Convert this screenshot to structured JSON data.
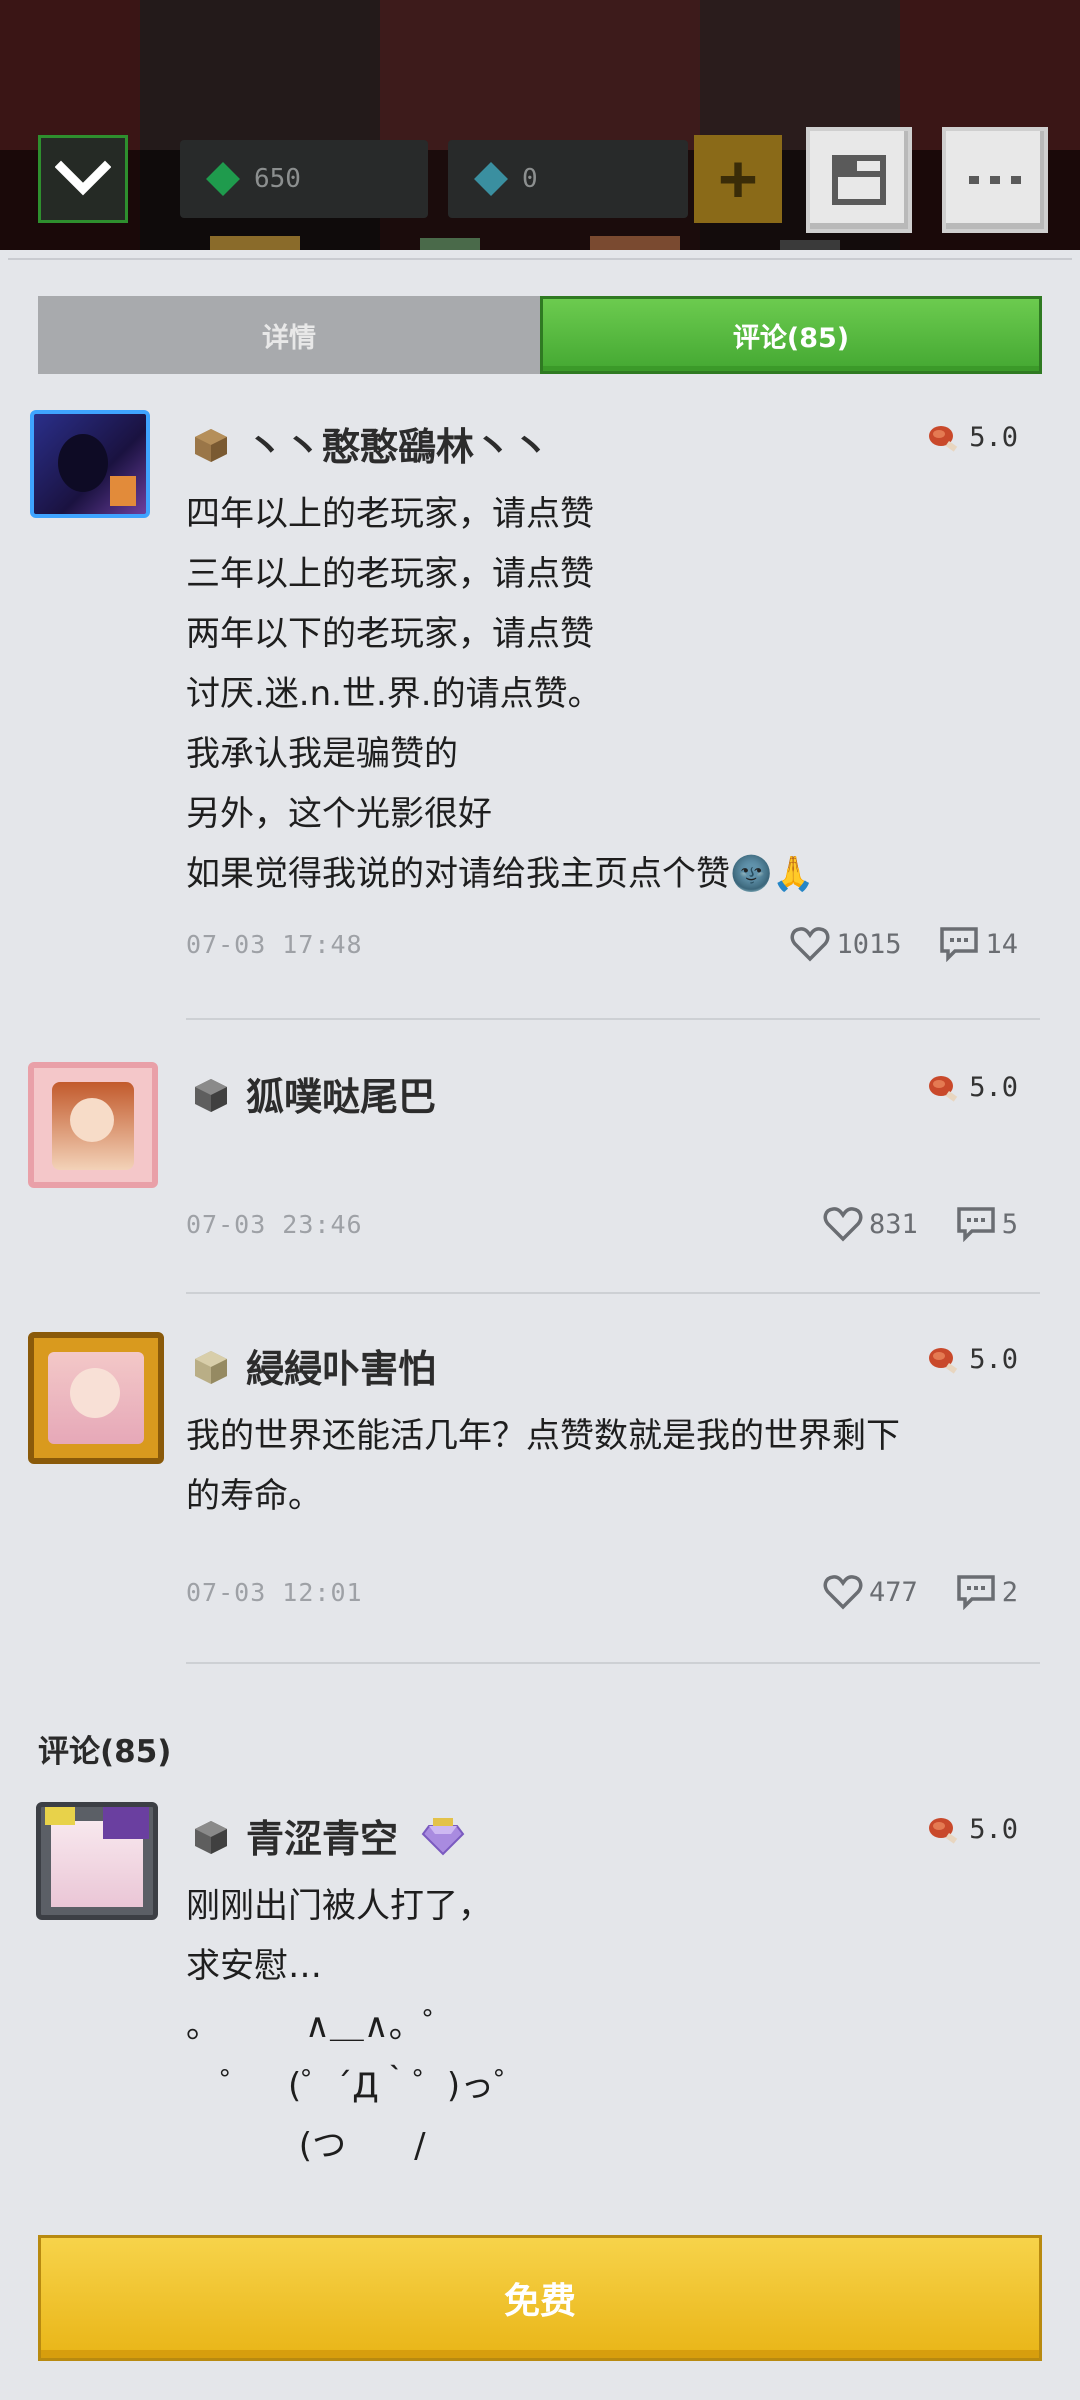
{
  "header": {
    "emerald_count": "650",
    "diamond_count": "0",
    "add_label": "+"
  },
  "tabs": [
    {
      "label": "详情"
    },
    {
      "label": "评论(85)"
    }
  ],
  "comments": [
    {
      "username": "丶丶憨憨鷂林丶丶",
      "rating": "5.0",
      "text": "四年以上的老玩家，请点赞\n三年以上的老玩家，请点赞\n两年以下的老玩家，请点赞\n讨厌.迷.n.世.界.的请点赞。\n我承认我是骗赞的\n另外，这个光影很好\n如果觉得我说的对请给我主页点个赞🌚🙏",
      "time": "07-03 17:48",
      "likes": "1015",
      "replies": "14"
    },
    {
      "username": "狐噗哒尾巴",
      "rating": "5.0",
      "text": "",
      "time": "07-03 23:46",
      "likes": "831",
      "replies": "5"
    },
    {
      "username": "綅綅卟害怕",
      "rating": "5.0",
      "text": "我的世界还能活几年？点赞数就是我的世界剩下\n的寿命。",
      "time": "07-03 12:01",
      "likes": "477",
      "replies": "2"
    }
  ],
  "section_title": "评论(85)",
  "comment4": {
    "username": "青涩青空",
    "rating": "5.0",
    "text": "刚刚出门被人打了，\n求安慰…\n。　　　∧＿∧。゜\n　゜　(゜´Д｀゜)っ゜\n　　　 (つ　　/"
  },
  "footer": {
    "button_label": "免费"
  },
  "colors": {
    "tab_active": "#52b63c",
    "button_yellow": "#f2c52e",
    "background": "#e4e6ea"
  }
}
